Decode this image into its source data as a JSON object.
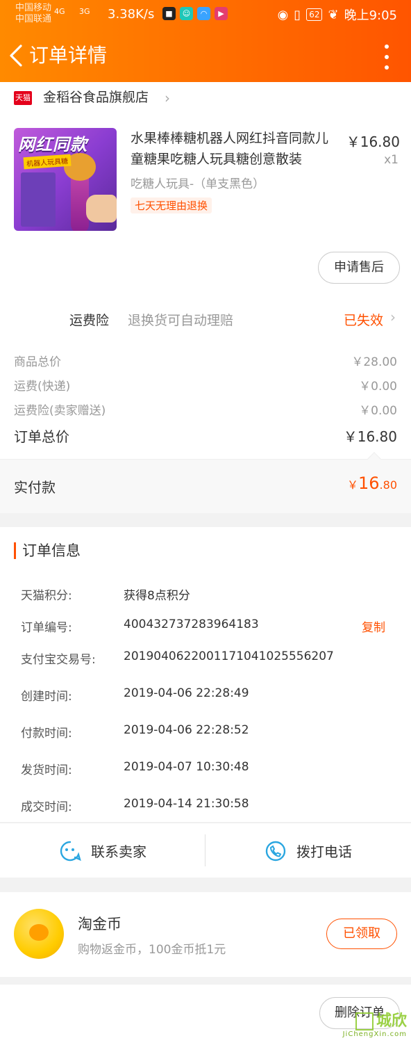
{
  "status_bar": {
    "carrier_1": "中国移动",
    "carrier_2": "中国联通",
    "sig_1": "4G",
    "sig_2": "3G",
    "net_speed": "3.38K/s",
    "battery": "62",
    "time": "晚上9:05"
  },
  "header": {
    "title": "订单详情"
  },
  "shop": {
    "badge": "天猫",
    "name": "金稻谷食品旗舰店"
  },
  "product": {
    "title": "水果棒棒糖机器人网红抖音同款儿童糖果吃糖人玩具糖创意散装",
    "price": "￥16.80",
    "qty": "x1",
    "sku": "吃糖人玩具-（单支黑色）",
    "tag": "七天无理由退换",
    "image_text": "网红同款",
    "image_sub": "机器人玩具糖",
    "aftersale_label": "申请售后"
  },
  "insurance": {
    "label": "运费险",
    "desc": "退换货可自动理赔",
    "status": "已失效"
  },
  "prices": {
    "rows": [
      {
        "label": "商品总价",
        "value": "￥28.00"
      },
      {
        "label": "运费(快递)",
        "value": "￥0.00"
      },
      {
        "label": "运费险(卖家赠送)",
        "value": "￥0.00"
      }
    ],
    "total_label": "订单总价",
    "total_value": "￥16.80",
    "paid_label": "实付款",
    "paid_currency": "￥",
    "paid_int": "16",
    "paid_dec": ".80"
  },
  "order_info": {
    "heading": "订单信息",
    "copy_label": "复制",
    "rows": [
      {
        "label": "天猫积分:",
        "value": "获得8点积分"
      },
      {
        "label": "订单编号:",
        "value": "400432737283964183"
      },
      {
        "label": "支付宝交易号:",
        "value": "2019040622001171041025556207"
      },
      {
        "label": "创建时间:",
        "value": "2019-04-06 22:28:49"
      },
      {
        "label": "付款时间:",
        "value": "2019-04-06 22:28:52"
      },
      {
        "label": "发货时间:",
        "value": "2019-04-07 10:30:48"
      },
      {
        "label": "成交时间:",
        "value": "2019-04-14 21:30:58"
      }
    ]
  },
  "contact": {
    "seller": "联系卖家",
    "phone": "拨打电话"
  },
  "coin": {
    "title": "淘金币",
    "desc": "购物返金币，100金币抵1元",
    "button": "已领取"
  },
  "bottom": {
    "delete_label": "删除订单"
  },
  "watermark": {
    "main": "城欣",
    "sub": "JiChengXin.com"
  },
  "colors": {
    "accent": "#ff5000",
    "header_start": "#ff8a00",
    "header_end": "#ff5500"
  }
}
